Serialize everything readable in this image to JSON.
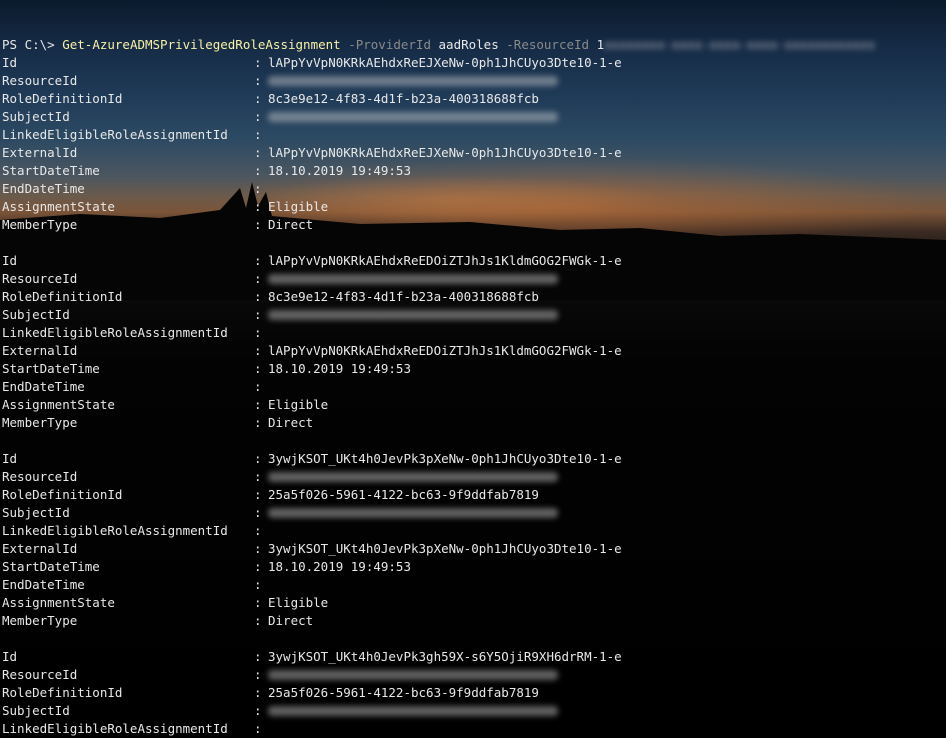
{
  "window": {
    "title": ""
  },
  "prompt": {
    "ps": "PS C:\\> ",
    "command": "Get-AzureADMSPrivilegedRoleAssignment",
    "provider_param": "-ProviderId",
    "provider_value": "aadRoles",
    "resource_param": "-ResourceId",
    "resource_value_visible": "1",
    "resource_value_redacted": "xxxxxxxx-xxxx-xxxx-xxxx-xxxxxxxxxxxx"
  },
  "separator": ":",
  "records": [
    {
      "fields": [
        {
          "key": "Id",
          "value": "lAPpYvVpN0KRkAEhdxReEJXeNw-0ph1JhCUyo3Dte10-1-e",
          "redacted": false
        },
        {
          "key": "ResourceId",
          "value": "",
          "redacted": true
        },
        {
          "key": "RoleDefinitionId",
          "value": "8c3e9e12-4f83-4d1f-b23a-400318688fcb",
          "redacted": false
        },
        {
          "key": "SubjectId",
          "value": "",
          "redacted": true
        },
        {
          "key": "LinkedEligibleRoleAssignmentId",
          "value": "",
          "redacted": false
        },
        {
          "key": "ExternalId",
          "value": "lAPpYvVpN0KRkAEhdxReEJXeNw-0ph1JhCUyo3Dte10-1-e",
          "redacted": false
        },
        {
          "key": "StartDateTime",
          "value": "18.10.2019 19:49:53",
          "redacted": false
        },
        {
          "key": "EndDateTime",
          "value": "",
          "redacted": false
        },
        {
          "key": "AssignmentState",
          "value": "Eligible",
          "redacted": false
        },
        {
          "key": "MemberType",
          "value": "Direct",
          "redacted": false
        }
      ]
    },
    {
      "fields": [
        {
          "key": "Id",
          "value": "lAPpYvVpN0KRkAEhdxReEDOiZTJhJs1KldmGOG2FWGk-1-e",
          "redacted": false
        },
        {
          "key": "ResourceId",
          "value": "",
          "redacted": true
        },
        {
          "key": "RoleDefinitionId",
          "value": "8c3e9e12-4f83-4d1f-b23a-400318688fcb",
          "redacted": false
        },
        {
          "key": "SubjectId",
          "value": "",
          "redacted": true
        },
        {
          "key": "LinkedEligibleRoleAssignmentId",
          "value": "",
          "redacted": false
        },
        {
          "key": "ExternalId",
          "value": "lAPpYvVpN0KRkAEhdxReEDOiZTJhJs1KldmGOG2FWGk-1-e",
          "redacted": false
        },
        {
          "key": "StartDateTime",
          "value": "18.10.2019 19:49:53",
          "redacted": false
        },
        {
          "key": "EndDateTime",
          "value": "",
          "redacted": false
        },
        {
          "key": "AssignmentState",
          "value": "Eligible",
          "redacted": false
        },
        {
          "key": "MemberType",
          "value": "Direct",
          "redacted": false
        }
      ]
    },
    {
      "fields": [
        {
          "key": "Id",
          "value": "3ywjKSOT_UKt4h0JevPk3pXeNw-0ph1JhCUyo3Dte10-1-e",
          "redacted": false
        },
        {
          "key": "ResourceId",
          "value": "",
          "redacted": true
        },
        {
          "key": "RoleDefinitionId",
          "value": "25a5f026-5961-4122-bc63-9f9ddfab7819",
          "redacted": false
        },
        {
          "key": "SubjectId",
          "value": "",
          "redacted": true
        },
        {
          "key": "LinkedEligibleRoleAssignmentId",
          "value": "",
          "redacted": false
        },
        {
          "key": "ExternalId",
          "value": "3ywjKSOT_UKt4h0JevPk3pXeNw-0ph1JhCUyo3Dte10-1-e",
          "redacted": false
        },
        {
          "key": "StartDateTime",
          "value": "18.10.2019 19:49:53",
          "redacted": false
        },
        {
          "key": "EndDateTime",
          "value": "",
          "redacted": false
        },
        {
          "key": "AssignmentState",
          "value": "Eligible",
          "redacted": false
        },
        {
          "key": "MemberType",
          "value": "Direct",
          "redacted": false
        }
      ]
    },
    {
      "fields": [
        {
          "key": "Id",
          "value": "3ywjKSOT_UKt4h0JevPk3gh59X-s6Y5OjiR9XH6drRM-1-e",
          "redacted": false
        },
        {
          "key": "ResourceId",
          "value": "",
          "redacted": true
        },
        {
          "key": "RoleDefinitionId",
          "value": "25a5f026-5961-4122-bc63-9f9ddfab7819",
          "redacted": false
        },
        {
          "key": "SubjectId",
          "value": "",
          "redacted": true
        },
        {
          "key": "LinkedEligibleRoleAssignmentId",
          "value": "",
          "redacted": false
        }
      ]
    }
  ]
}
